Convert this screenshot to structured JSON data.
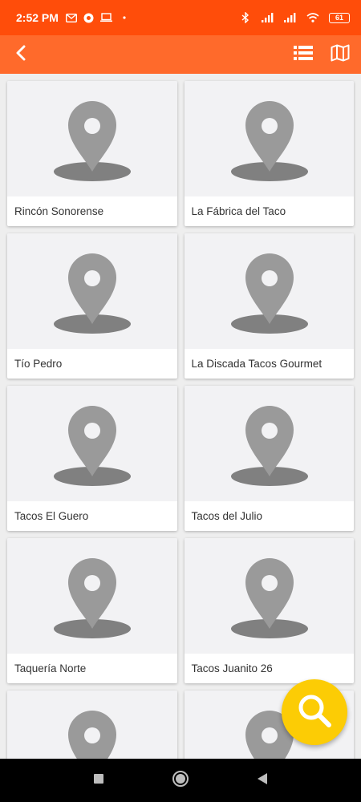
{
  "status_bar": {
    "time": "2:52 PM",
    "notification_icons": [
      "gmail-icon",
      "chrome-icon",
      "laptop-icon",
      "dot-icon"
    ],
    "system_icons": [
      "bluetooth-icon",
      "signal-icon",
      "signal-icon",
      "wifi-icon"
    ],
    "battery": "61"
  },
  "app_bar": {
    "back_icon": "chevron-left-icon",
    "list_view_icon": "list-icon",
    "map_view_icon": "map-icon",
    "color": "#ff6a2b"
  },
  "places": [
    {
      "name": "Rincón Sonorense"
    },
    {
      "name": "La Fábrica del Taco"
    },
    {
      "name": "Tío Pedro"
    },
    {
      "name": "La Discada Tacos Gourmet"
    },
    {
      "name": "Tacos El Guero"
    },
    {
      "name": "Tacos del Julio"
    },
    {
      "name": "Taquería Norte"
    },
    {
      "name": "Tacos Juanito 26"
    },
    {
      "name": ""
    },
    {
      "name": ""
    }
  ],
  "fab": {
    "icon": "search-icon",
    "color": "#fccc05"
  },
  "nav_bar": {
    "icons": [
      "recents-square-icon",
      "home-circle-icon",
      "back-triangle-icon"
    ]
  }
}
